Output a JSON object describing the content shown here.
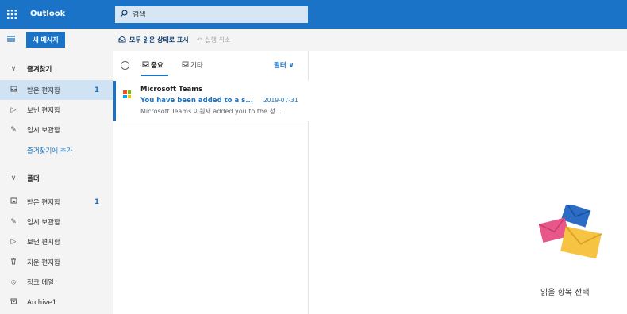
{
  "app": {
    "brand": "Outlook"
  },
  "search": {
    "placeholder": "검색"
  },
  "toolbar": {
    "new_message_label": "새 메시지"
  },
  "commands": {
    "mark_all_read": "모두 읽은 상태로 표시",
    "undo": "실행 취소"
  },
  "nav": {
    "favorites_header": "즐겨찾기",
    "favorites": [
      {
        "label": "받은 편지함",
        "count": "1",
        "icon": "inbox-icon"
      },
      {
        "label": "보낸 편지함",
        "count": "",
        "icon": "send-icon"
      },
      {
        "label": "임시 보관함",
        "count": "",
        "icon": "pencil-icon"
      }
    ],
    "add_favorite": "즐겨찾기에 추가",
    "folders_header": "폴더",
    "folders": [
      {
        "label": "받은 편지함",
        "count": "1",
        "icon": "inbox-icon"
      },
      {
        "label": "임시 보관함",
        "count": "",
        "icon": "pencil-icon"
      },
      {
        "label": "보낸 편지함",
        "count": "",
        "icon": "send-icon"
      },
      {
        "label": "지운 편지함",
        "count": "",
        "icon": "trash-icon"
      },
      {
        "label": "정크 메일",
        "count": "",
        "icon": "block-icon"
      },
      {
        "label": "Archive1",
        "count": "",
        "icon": "archive-icon"
      }
    ]
  },
  "list": {
    "tabs": {
      "focused": "중요",
      "other": "기타"
    },
    "filter": "필터",
    "messages": [
      {
        "sender": "Microsoft Teams",
        "subject": "You have been added to a s...",
        "date": "2019-07-31",
        "preview": "Microsoft Teams 이원재 added you to the 청..."
      }
    ]
  },
  "reading": {
    "empty_hint": "읽을 항목 선택"
  },
  "colors": {
    "accent": "#1a73c6",
    "selected_bg": "#cfe3f5",
    "nav_bg": "#f4f4f4"
  }
}
